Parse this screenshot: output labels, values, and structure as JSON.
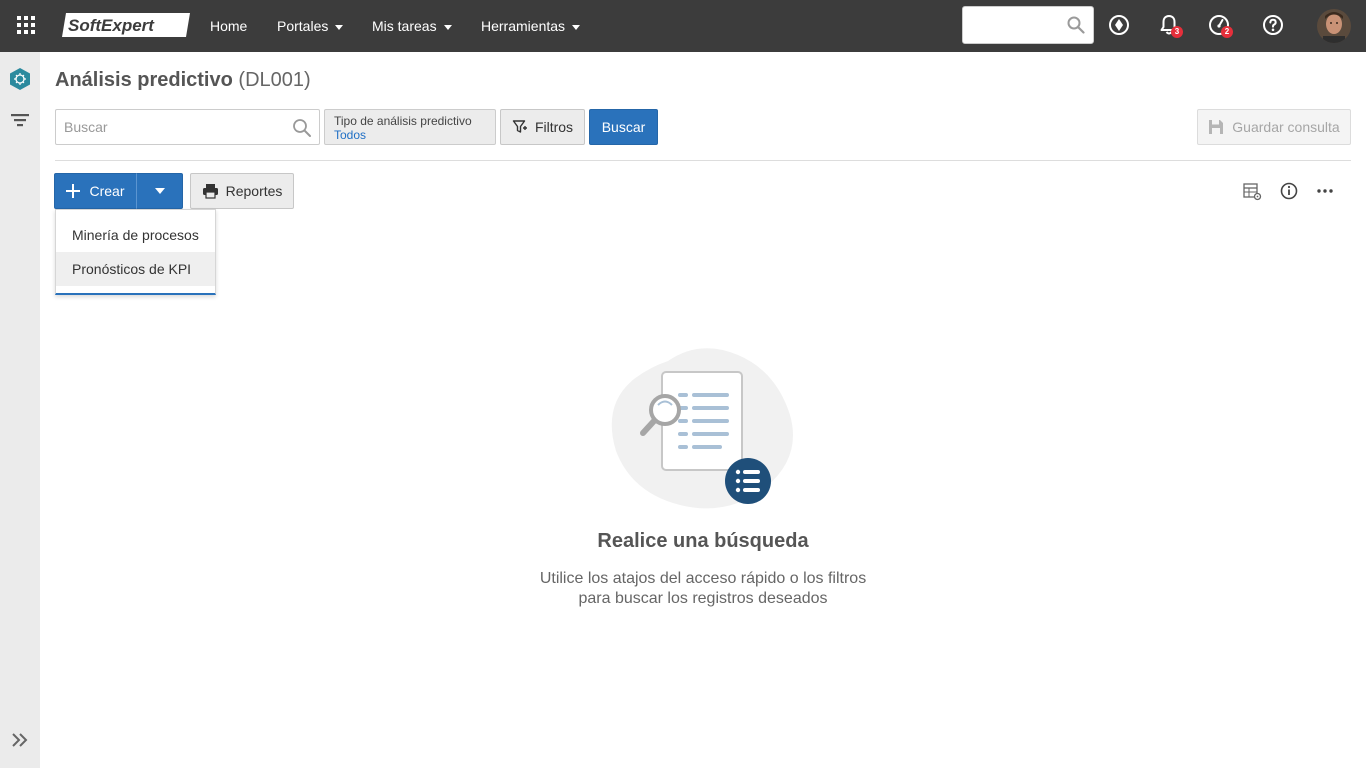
{
  "topbar": {
    "logo": "SoftExpert",
    "nav": {
      "home": "Home",
      "portales": "Portales",
      "mis_tareas": "Mis tareas",
      "herramientas": "Herramientas"
    },
    "search_value": "",
    "notifications_count": "3",
    "tasks_count": "2",
    "icons": [
      "apps-grid-icon",
      "compass-icon",
      "bell-icon",
      "gauge-icon",
      "help-icon"
    ]
  },
  "sidebar": {
    "icons": [
      "predictive-analysis-icon",
      "filter-icon",
      "expand-icon"
    ]
  },
  "page": {
    "title": "Análisis predictivo",
    "code": "(DL001)"
  },
  "search": {
    "placeholder": "Buscar",
    "type_label": "Tipo de análisis predictivo",
    "type_value": "Todos",
    "filters_label": "Filtros",
    "search_button": "Buscar",
    "save_query_label": "Guardar consulta"
  },
  "toolbar": {
    "create_label": "Crear",
    "reports_label": "Reportes",
    "create_menu": [
      {
        "label": "Minería de procesos"
      },
      {
        "label": "Pronósticos de KPI"
      }
    ]
  },
  "empty_state": {
    "title": "Realice una búsqueda",
    "description": "Utilice los atajos del acceso rápido o los filtros para buscar los registros deseados"
  },
  "colors": {
    "topbar_bg": "#3c3c3c",
    "accent_blue": "#2a72bb",
    "badge_red": "#e62f3b",
    "link_blue": "#1f6fc5",
    "illustration_dark": "#1f4f7a"
  }
}
